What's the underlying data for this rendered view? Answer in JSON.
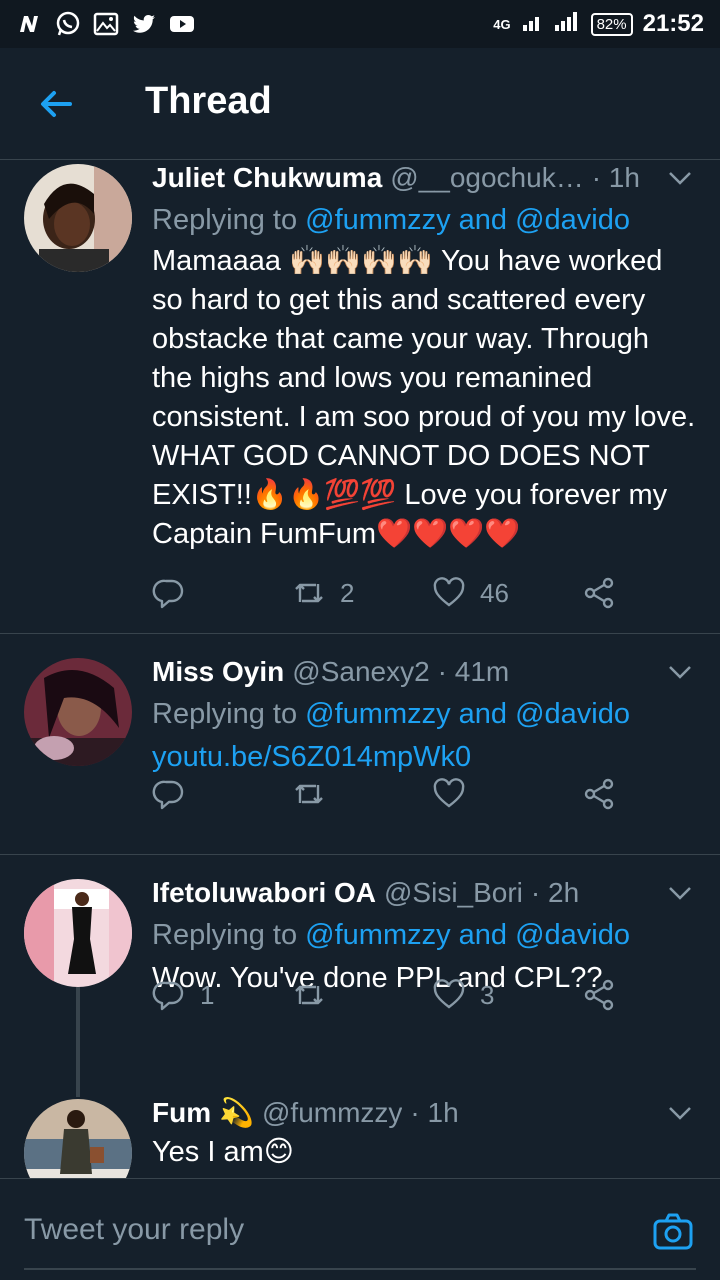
{
  "status_bar": {
    "network": "4G",
    "battery": "82%",
    "time": "21:52"
  },
  "header": {
    "title": "Thread"
  },
  "tweets": [
    {
      "name": "Juliet Chukwuma",
      "handle": "@__ogochuk…",
      "time": "· 1h",
      "replying_prefix": "Replying to ",
      "replying_users": "@fummzzy and @davido",
      "body": "Mamaaaa 🙌🏻🙌🏻🙌🏻🙌🏻 You have worked so hard to get this and scattered every obstacke that came your way. Through the highs and lows you remanined consistent. I am soo proud of you my love. WHAT GOD CANNOT DO DOES NOT EXIST!!🔥🔥💯💯 Love you forever my Captain FumFum❤️❤️❤️❤️",
      "replies": "",
      "retweets": "2",
      "likes": "46"
    },
    {
      "name": "Miss Oyin",
      "handle": "@Sanexy2",
      "time": "· 41m",
      "replying_prefix": "Replying to ",
      "replying_users": "@fummzzy and @davido",
      "body": "youtu.be/S6Z014mpWk0",
      "replies": "",
      "retweets": "",
      "likes": ""
    },
    {
      "name": "Ifetoluwabori OA",
      "handle": "@Sisi_Bori",
      "time": "· 2h",
      "replying_prefix": "Replying to ",
      "replying_users": "@fummzzy and @davido",
      "body": "Wow. You've done PPL and CPL??",
      "replies": "1",
      "retweets": "",
      "likes": "3"
    },
    {
      "name": "Fum",
      "name_emoji": "💫",
      "handle": "@fummzzy",
      "time": "· 1h",
      "body": "Yes I am😊"
    }
  ],
  "reply_bar": {
    "placeholder": "Tweet your reply"
  },
  "colors": {
    "background": "#15202b",
    "accent": "#1da1f2",
    "muted": "#8899a6",
    "divider": "#38444d"
  }
}
